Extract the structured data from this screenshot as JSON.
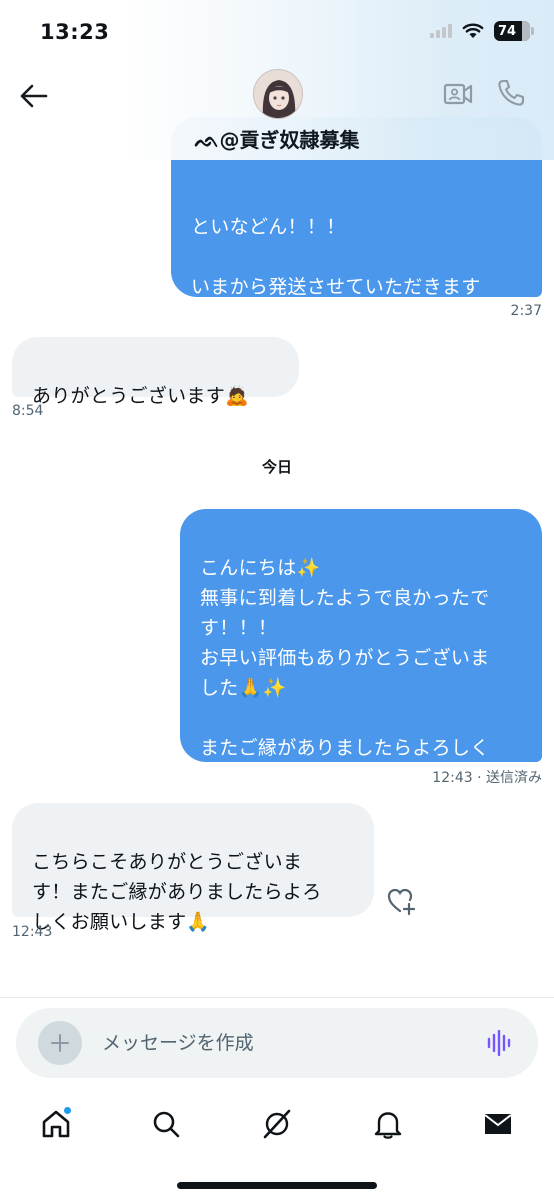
{
  "status_bar": {
    "time": "13:23",
    "battery": "74"
  },
  "header": {
    "contact_name": "ᨒ@貢ぎ奴隷募集",
    "back_icon": "arrow-left-icon",
    "video_icon": "video-call-icon",
    "phone_icon": "phone-icon"
  },
  "messages": [
    {
      "direction": "out",
      "text": "といなどん！！！\n\nいまから発送させていただきます\nので引き続きよろしくお願いしま\nす(><)",
      "time": "2:37"
    },
    {
      "direction": "in",
      "text": "ありがとうございます🙇",
      "time": "8:54"
    },
    {
      "direction": "separator",
      "text": "今日"
    },
    {
      "direction": "out",
      "text": "こんにちは✨\n無事に到着したようで良かったで\nす！！！\nお早い評価もありがとうございま\nした🙏✨\n\nまたご縁がありましたらよろしく\nお願いします😊",
      "time": "12:43 · 送信済み"
    },
    {
      "direction": "in",
      "text": "こちらこそありがとうございま\nす！またご縁がありましたらよろ\nしくお願いします🙏",
      "time": "12:43"
    }
  ],
  "composer": {
    "placeholder": "メッセージを作成"
  },
  "colors": {
    "outgoing_bubble": "#4a97ec",
    "incoming_bubble": "#eff2f4",
    "accent": "#1d9bf0"
  },
  "tabbar": {
    "items": [
      "home-icon",
      "search-icon",
      "grok-icon",
      "notifications-icon",
      "messages-icon"
    ]
  }
}
